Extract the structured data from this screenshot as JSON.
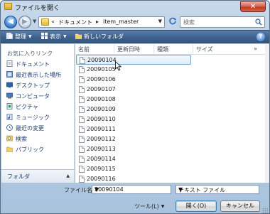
{
  "window": {
    "title": "ファイルを開く",
    "close_label": "✕"
  },
  "address": {
    "path_prefix": "«",
    "segments": [
      "ドキュメント",
      "item_master"
    ],
    "separator": "▸"
  },
  "search": {
    "placeholder": "検索"
  },
  "toolbar": {
    "organize_label": "整理",
    "views_label": "表示",
    "new_folder_label": "新しいフォルダ",
    "help_label": "?"
  },
  "navpane": {
    "favorites_header": "お気に入りリンク",
    "items": [
      {
        "label": "ドキュメント",
        "icon": "documents-icon"
      },
      {
        "label": "最近表示した場所",
        "icon": "recent-places-icon"
      },
      {
        "label": "デスクトップ",
        "icon": "desktop-icon"
      },
      {
        "label": "コンピュータ",
        "icon": "computer-icon"
      },
      {
        "label": "ピクチャ",
        "icon": "pictures-icon"
      },
      {
        "label": "ミュージック",
        "icon": "music-icon"
      },
      {
        "label": "最近の変更",
        "icon": "recently-changed-icon"
      },
      {
        "label": "検索",
        "icon": "searches-icon"
      },
      {
        "label": "パブリック",
        "icon": "public-folder-icon"
      }
    ],
    "folders_label": "フォルダ"
  },
  "filelist": {
    "columns": [
      "名前",
      "更新日時",
      "種類",
      "サイズ"
    ],
    "more": "»",
    "files": [
      "20090104",
      "20090105",
      "20090106",
      "20090107",
      "20090108",
      "20090109",
      "20090110",
      "20090111",
      "20090112",
      "20090113",
      "20090114",
      "20090115",
      "20090116"
    ],
    "selected_index": 0
  },
  "footer": {
    "filename_label": "ファイル名(N):",
    "filename_value": "20090104",
    "filetype_value": "テキスト ファイル",
    "tools_label": "ツール(L)",
    "open_label": "開く(O)",
    "cancel_label": "キャンセル"
  }
}
